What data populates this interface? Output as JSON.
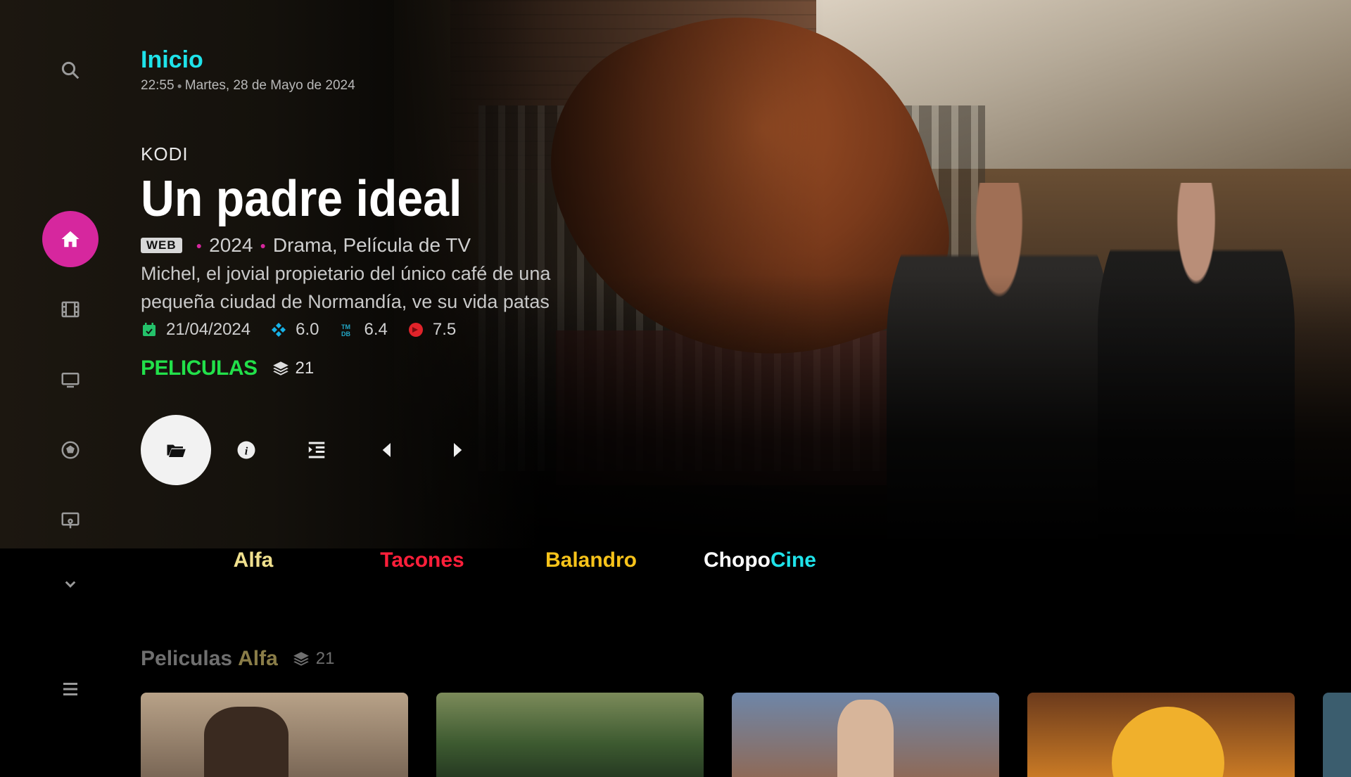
{
  "header": {
    "title": "Inicio",
    "time": "22:55",
    "date": "Martes, 28 de Mayo de 2024"
  },
  "sidebar": {
    "items": [
      {
        "icon": "search-icon",
        "label": "Buscar"
      },
      {
        "icon": "home-icon",
        "label": "Inicio",
        "active": true
      },
      {
        "icon": "film-icon",
        "label": "Películas"
      },
      {
        "icon": "tv-icon",
        "label": "Series"
      },
      {
        "icon": "soccer-ball-icon",
        "label": "Deportes"
      },
      {
        "icon": "live-tv-icon",
        "label": "TV"
      },
      {
        "icon": "chevron-down-icon",
        "label": "Más"
      },
      {
        "icon": "menu-icon",
        "label": "Menú"
      }
    ]
  },
  "featured": {
    "provider": "KODI",
    "title": "Un padre ideal",
    "badge": "WEB",
    "year": "2024",
    "genres": "Drama, Película de TV",
    "plot": "Michel, el jovial propietario del único café de una pequeña ciudad de Normandía, ve su vida patas",
    "release_date": "21/04/2024",
    "rating_kodi": "6.0",
    "rating_tmdb": "6.4",
    "rating_other": "7.5",
    "collection": "PELICULAS",
    "collection_count": "21"
  },
  "actions": [
    {
      "icon": "folder-open-icon",
      "name": "browse"
    },
    {
      "icon": "info-icon",
      "name": "info"
    },
    {
      "icon": "list-indent-icon",
      "name": "list"
    },
    {
      "icon": "previous-icon",
      "name": "previous"
    },
    {
      "icon": "next-icon",
      "name": "next"
    }
  ],
  "brands": {
    "alfa": "Alfa",
    "tacones": "Tacones",
    "balandro": "Balandro",
    "chopo_part1": "Chopo",
    "chopo_part2": "Cine"
  },
  "row": {
    "title_part1": "Peliculas",
    "title_part2": "Alfa",
    "count": "21"
  },
  "colors": {
    "accent_pink": "#d6279e",
    "title_cyan": "#1fe3ea",
    "collection_green": "#22e04a"
  }
}
